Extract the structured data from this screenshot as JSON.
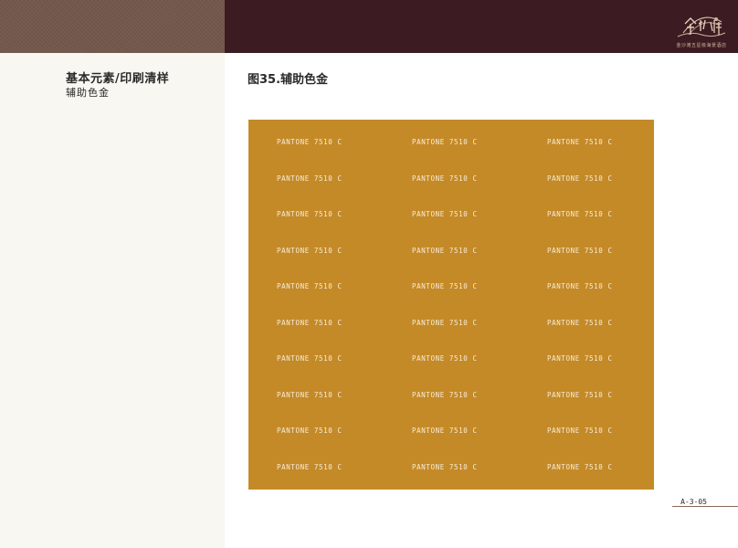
{
  "header": {
    "logo": {
      "wordmark": "金沙滩",
      "tagline": "金沙滩五星级海景酒店"
    }
  },
  "section": {
    "title": "基本元素/印刷清样",
    "subtitle": "辅助色金"
  },
  "figure": {
    "title": "图35.辅助色金",
    "swatch_color": "#c48a28",
    "label_color": "#f7ecd6",
    "labels": [
      "PANTONE 7510 C",
      "PANTONE 7510 C",
      "PANTONE 7510 C",
      "PANTONE 7510 C",
      "PANTONE 7510 C",
      "PANTONE 7510 C",
      "PANTONE 7510 C",
      "PANTONE 7510 C",
      "PANTONE 7510 C",
      "PANTONE 7510 C",
      "PANTONE 7510 C",
      "PANTONE 7510 C",
      "PANTONE 7510 C",
      "PANTONE 7510 C",
      "PANTONE 7510 C",
      "PANTONE 7510 C",
      "PANTONE 7510 C",
      "PANTONE 7510 C",
      "PANTONE 7510 C",
      "PANTONE 7510 C",
      "PANTONE 7510 C",
      "PANTONE 7510 C",
      "PANTONE 7510 C",
      "PANTONE 7510 C",
      "PANTONE 7510 C",
      "PANTONE 7510 C",
      "PANTONE 7510 C",
      "PANTONE 7510 C",
      "PANTONE 7510 C",
      "PANTONE 7510 C"
    ]
  },
  "footer": {
    "page_number": "A-3-05"
  },
  "colors": {
    "header_left": "#73584c",
    "header_right": "#3c1b22",
    "left_pane": "#f8f7f2"
  }
}
